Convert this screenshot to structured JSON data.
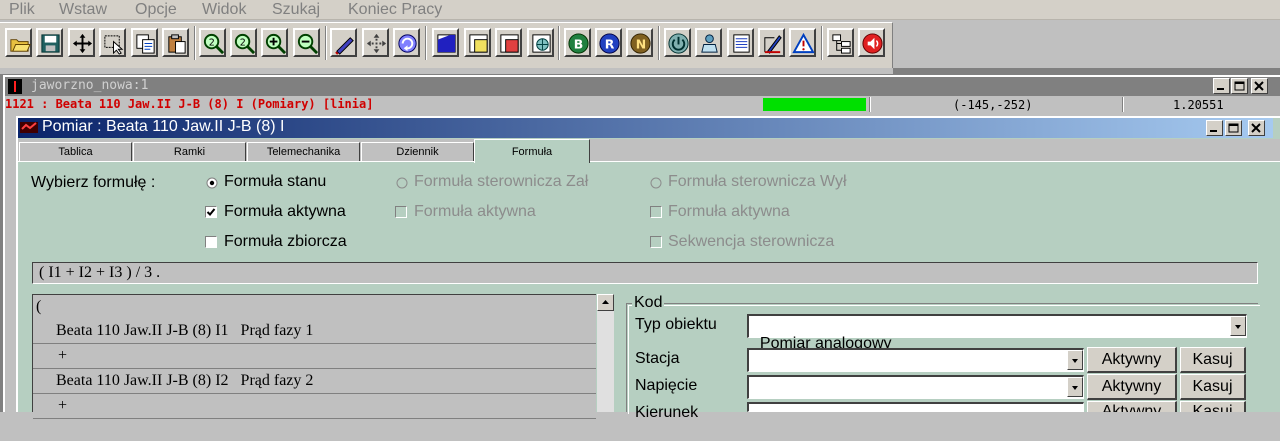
{
  "menu": [
    "Plik",
    "Wstaw",
    "Opcje",
    "Widok",
    "Szukaj",
    "Koniec Pracy"
  ],
  "toolbar_icons": [
    "open-folder-icon",
    "save-icon",
    "move-arrows-icon",
    "select-cursor-icon",
    "copy-icon",
    "paste-icon",
    "zoom-2-icon",
    "zoom-reset-icon",
    "zoom-in-icon",
    "zoom-out-icon",
    "draw-line-icon",
    "pan-icon",
    "refresh-icon",
    "layer-blue-icon",
    "layer-yellow-icon",
    "layer-red-icon",
    "layer-grid-icon",
    "b-circle-icon",
    "r-circle-icon",
    "n-circle-icon",
    "power-icon",
    "user-icon",
    "list-icon",
    "edit-doc-icon",
    "warning-icon",
    "tree-icon",
    "sound-icon"
  ],
  "mdi": {
    "title": "jaworzno_nowa:1",
    "status_text": "1121 : Beata 110 Jaw.II J-B (8) I (Pomiary) [linia]",
    "coords": "(-145,-252)",
    "zoom": "1.20551",
    "accent_green": "#00e000"
  },
  "dialog": {
    "title": "Pomiar : Beata 110 Jaw.II J-B (8) I",
    "tabs": [
      "Tablica",
      "Ramki",
      "Telemechanika",
      "Dziennik",
      "Formuła"
    ],
    "active_tab": "Formuła",
    "choose_label": "Wybierz formułę :",
    "col1": {
      "radio": "Formuła stanu",
      "active_check": "Formuła aktywna",
      "aggregate_check": "Formuła zbiorcza",
      "radio_selected": true,
      "active_checked": true,
      "aggregate_checked": false
    },
    "col2": {
      "radio": "Formuła sterownicza Zał",
      "active_check": "Formuła aktywna"
    },
    "col3": {
      "radio": "Formuła sterownicza Wył",
      "active_check": "Formuła aktywna",
      "sequence_check": "Sekwencja sterownicza"
    },
    "formula_text": "( I1 + I2 + I3 ) / 3 .",
    "list_rows": [
      "(",
      "Beata 110 Jaw.II J-B (8) I1   Prąd fazy 1",
      "+",
      "Beata 110 Jaw.II J-B (8) I2   Prąd fazy 2",
      "+"
    ],
    "kod": {
      "title": "Kod",
      "object_type_label": "Typ obiektu",
      "object_type_value": "Pomiar analogowy",
      "fields": [
        {
          "label": "Stacja",
          "value": "",
          "active_button": "Aktywny",
          "clear_button": "Kasuj"
        },
        {
          "label": "Napięcie",
          "value": "",
          "active_button": "Aktywny",
          "clear_button": "Kasuj"
        },
        {
          "label": "Kierunek",
          "value": "",
          "active_button": "Aktywny",
          "clear_button": "Kasuj"
        }
      ]
    }
  }
}
